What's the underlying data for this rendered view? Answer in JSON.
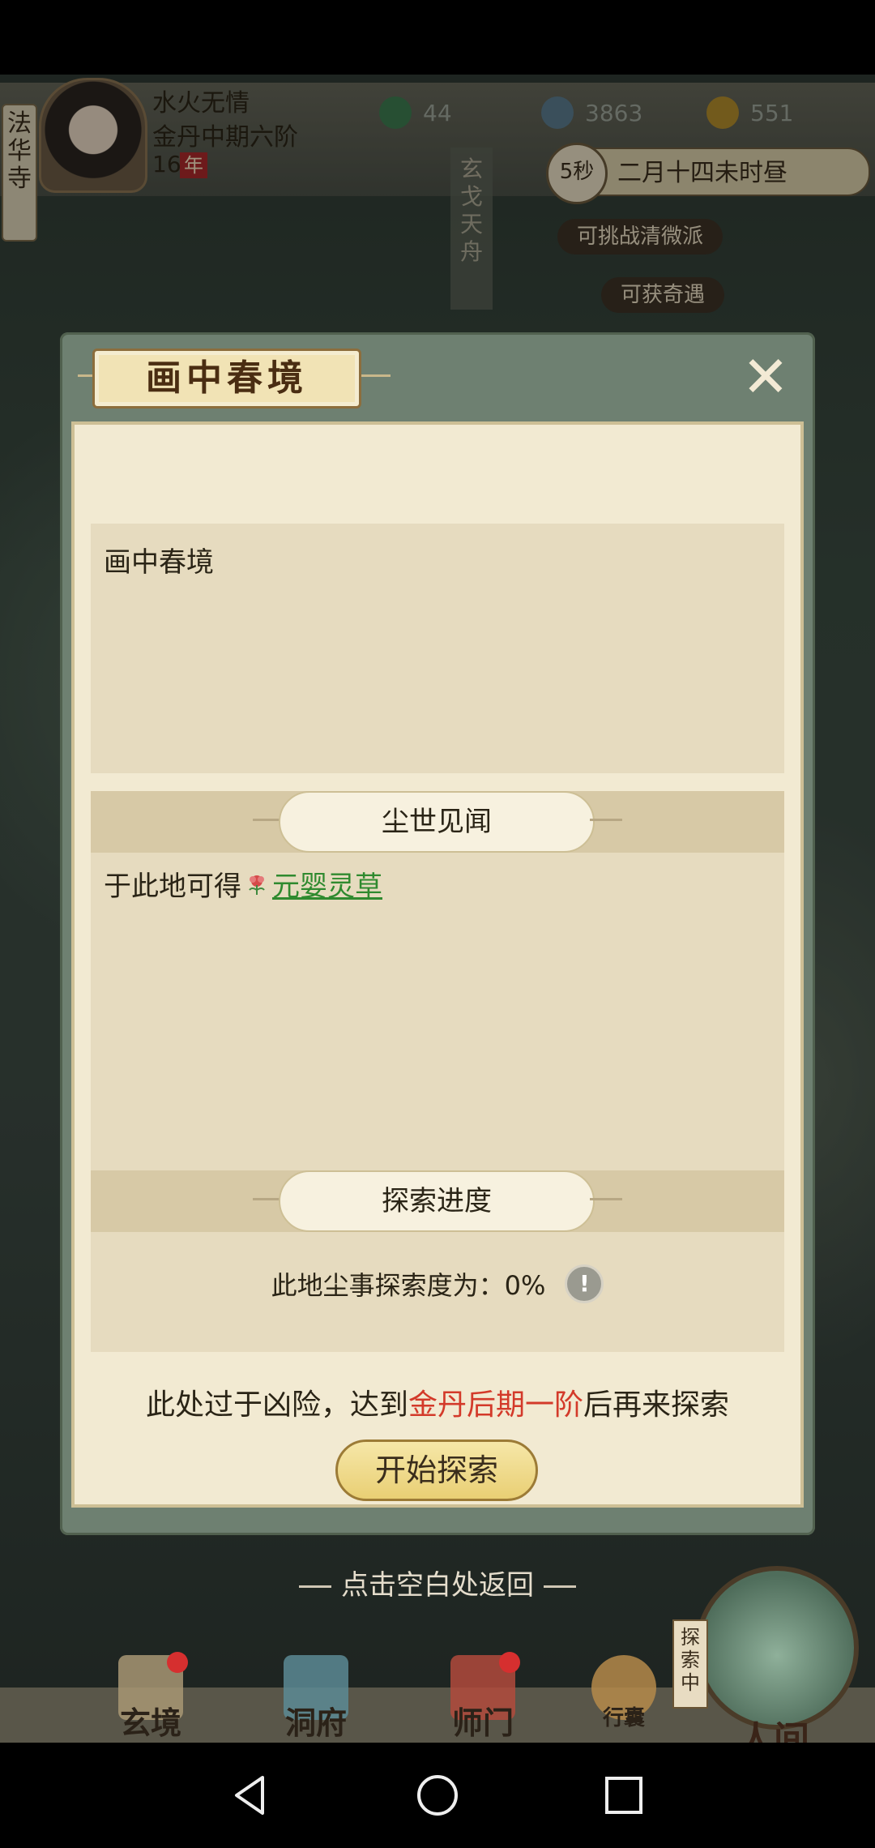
{
  "hud": {
    "temple_tab": "法华寺",
    "player_name": "水火无情",
    "player_realm": "金丹中期六阶",
    "player_age": "16",
    "age_unit": "年",
    "resource_jade": "44",
    "resource_coin": "3863",
    "resource_gold": "551",
    "timer": "5秒",
    "date": "二月十四未时昼",
    "vertical_banner": "玄戈天舟",
    "event_challenge": "可挑战清微派",
    "event_encounter": "可获奇遇"
  },
  "dialog": {
    "title": "画中春境",
    "description": "画中春境",
    "section_rewards_title": "尘世见闻",
    "reward_prefix": "于此地可得",
    "reward_item": "元婴灵草",
    "section_progress_title": "探索进度",
    "progress_label": "此地尘事探索度为：",
    "progress_value": "0%",
    "warning_prefix": "此处过于凶险，达到",
    "warning_requirement": "金丹后期一阶",
    "warning_suffix": "后再来探索",
    "start_button": "开始探索",
    "close_icon": "close-icon"
  },
  "close_hint": "点击空白处返回",
  "bottom_nav": {
    "items": [
      {
        "label": "玄境",
        "badge": true
      },
      {
        "label": "洞府",
        "badge": false
      },
      {
        "label": "师门",
        "badge": true
      },
      {
        "label": "行囊",
        "badge": false
      }
    ],
    "world_tag": "探索中",
    "world_label": "人间"
  },
  "colors": {
    "accent_red": "#d33a2a",
    "reward_green": "#2f8a2f",
    "panel": "#f2ead2"
  }
}
